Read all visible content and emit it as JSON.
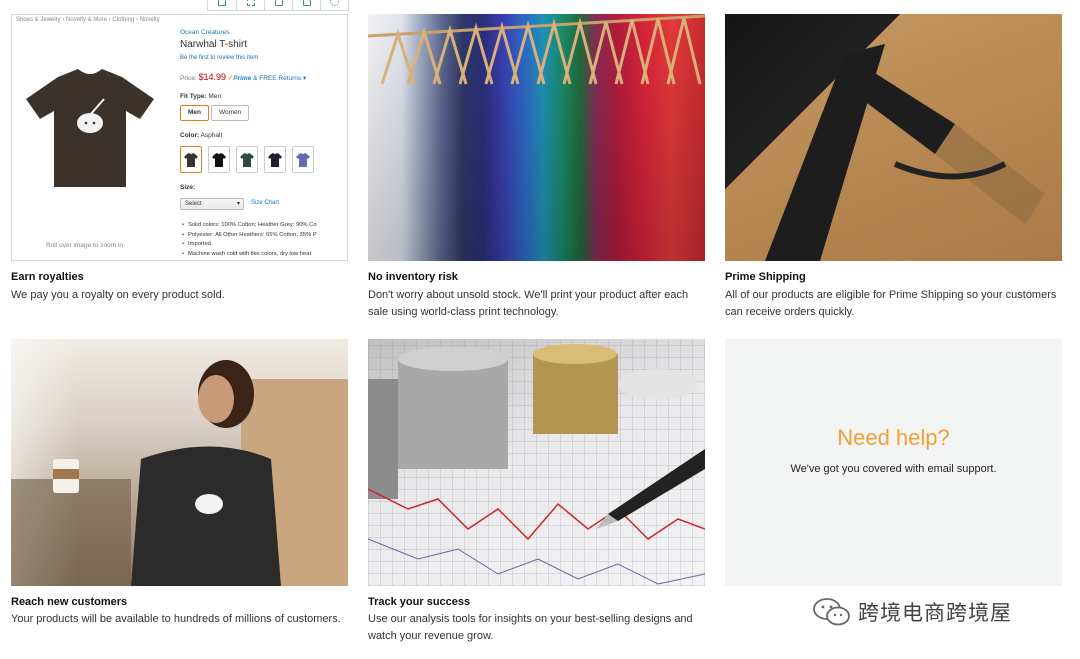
{
  "product_mockup": {
    "breadcrumb": "Shoes & Jewelry  ›  Novelty & More  ›  Clothing  ›  Novelty",
    "brand": "Ocean Creatures",
    "title": "Narwhal T-shirt",
    "review_link": "Be the first to review this item",
    "price_label": "Price:",
    "price": "$14.99",
    "prime_label": "Prime",
    "free_returns": "& FREE Returns",
    "fit_type_label": "Fit Type:",
    "fit_type_value": "Men",
    "fit_options": [
      "Men",
      "Women"
    ],
    "color_label": "Color:",
    "color_value": "Asphalt",
    "swatch_colors": [
      "#3b322c",
      "#111111",
      "#2f4a40",
      "#1c2038",
      "#5e6dab"
    ],
    "size_label": "Size:",
    "size_select": "Select",
    "size_chart": "Size Chart",
    "bullets": [
      "Solid colors: 100% Cotton; Heather Grey: 90% Co",
      "Polyester; All Other Heathers: 65% Cotton, 35% P",
      "Imported",
      "Machine wash cold with like colors, dry low heat"
    ],
    "rollover": "Roll over image to zoom in",
    "toolbar_icons": [
      "save-icon",
      "expand-icon",
      "save-icon",
      "share-icon",
      "settings-icon"
    ]
  },
  "features": [
    {
      "title": "Earn royalties",
      "text": "We pay you a royalty on every product sold."
    },
    {
      "title": "No inventory risk",
      "text": "Don't worry about unsold stock. We'll print your product after each sale using world-class print technology."
    },
    {
      "title": "Prime Shipping",
      "text": "All of our products are eligible for Prime Shipping so your customers can receive orders quickly."
    },
    {
      "title": "Reach new customers",
      "text": "Your products will be available to hundreds of millions of customers."
    },
    {
      "title": "Track your success",
      "text": "Use our analysis tools for insights on your best-selling designs and watch your revenue grow."
    }
  ],
  "help": {
    "heading": "Need help?",
    "text": "We've got you covered with email support."
  },
  "watermark": "跨境电商跨境屋",
  "colors": {
    "accent_orange": "#f0a036",
    "link_blue": "#1a73b8",
    "price_red": "#c40000"
  }
}
